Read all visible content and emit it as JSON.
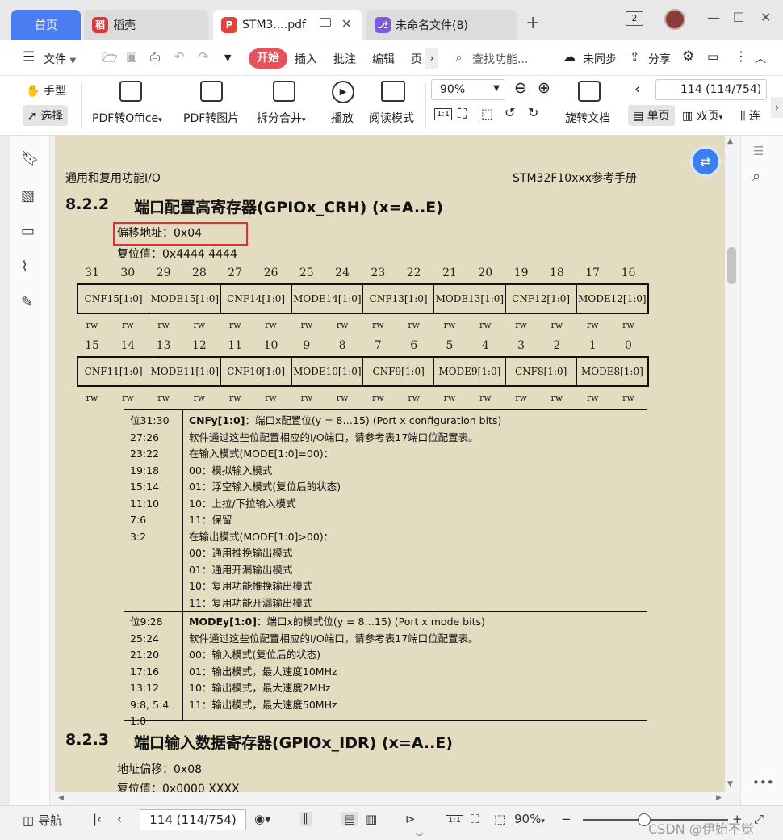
{
  "tabs": [
    {
      "label": "首页",
      "active": false,
      "home": true
    },
    {
      "label": "稻壳",
      "active": false
    },
    {
      "label": "STM3....pdf",
      "active": true
    },
    {
      "label": "未命名文件(8)",
      "active": false
    }
  ],
  "window": {
    "badge": "2"
  },
  "menu": {
    "file": "文件",
    "start": "开始",
    "items": [
      "插入",
      "批注",
      "编辑",
      "页"
    ],
    "search_placeholder": "查找功能...",
    "sync": "未同步",
    "share": "分享"
  },
  "toolbar": {
    "hand": "手型",
    "select": "选择",
    "pdf_office": "PDF转Office",
    "pdf_image": "PDF转图片",
    "split_merge": "拆分合并",
    "play": "播放",
    "read_mode": "阅读模式",
    "zoom": "90%",
    "page_input": "114 (114/754)",
    "rotate": "旋转文档",
    "single": "单页",
    "double": "双页",
    "continuous": "连"
  },
  "doc": {
    "header_left": "通用和复用功能I/O",
    "header_right": "STM32F10xxx参考手册",
    "sec1_num": "8.2.2",
    "sec1_title": "端口配置高寄存器(GPIOx_CRH) (x=A..E)",
    "offset": "偏移地址：0x04",
    "reset": "复位值：0x4444 4444",
    "bits_high": [
      "31",
      "30",
      "29",
      "28",
      "27",
      "26",
      "25",
      "24",
      "23",
      "22",
      "21",
      "20",
      "19",
      "18",
      "17",
      "16"
    ],
    "fields_high": [
      "CNF15[1:0]",
      "MODE15[1:0]",
      "CNF14[1:0]",
      "MODE14[1:0]",
      "CNF13[1:0]",
      "MODE13[1:0]",
      "CNF12[1:0]",
      "MODE12[1:0]"
    ],
    "bits_low": [
      "15",
      "14",
      "13",
      "12",
      "11",
      "10",
      "9",
      "8",
      "7",
      "6",
      "5",
      "4",
      "3",
      "2",
      "1",
      "0"
    ],
    "fields_low": [
      "CNF11[1:0]",
      "MODE11[1:0]",
      "CNF10[1:0]",
      "MODE10[1:0]",
      "CNF9[1:0]",
      "MODE9[1:0]",
      "CNF8[1:0]",
      "MODE8[1:0]"
    ],
    "rw": "rw",
    "cnf_bits": [
      "位31:30",
      "27:26",
      "23:22",
      "19:18",
      "15:14",
      "11:10",
      "7:6",
      "3:2"
    ],
    "cnf_title": "CNFy[1:0]",
    "cnf_title_rest": "：端口x配置位(y = 8…15) (Port x configuration bits)",
    "cnf_lines": [
      "软件通过这些位配置相应的I/O端口，请参考表17端口位配置表。",
      "在输入模式(MODE[1:0]=00)：",
      "00：模拟输入模式",
      "01：浮空输入模式(复位后的状态)",
      "10：上拉/下拉输入模式",
      "11：保留",
      "在输出模式(MODE[1:0]>00)：",
      "00：通用推挽输出模式",
      "01：通用开漏输出模式",
      "10：复用功能推挽输出模式",
      "11：复用功能开漏输出模式"
    ],
    "mode_bits": [
      "位9:28",
      "25:24",
      "21:20",
      "17:16",
      "13:12",
      "9:8, 5:4",
      "1:0"
    ],
    "mode_title": "MODEy[1:0]",
    "mode_title_rest": "：端口x的模式位(y = 8…15) (Port x mode bits)",
    "mode_lines": [
      "软件通过这些位配置相应的I/O端口，请参考表17端口位配置表。",
      "00：输入模式(复位后的状态)",
      "01：输出模式，最大速度10MHz",
      "10：输出模式，最大速度2MHz",
      "11：输出模式，最大速度50MHz"
    ],
    "sec2_num": "8.2.3",
    "sec2_title": "端口输入数据寄存器(GPIOx_IDR) (x=A..E)",
    "sec2_offset": "地址偏移：0x08",
    "sec2_reset": "复位值：0x0000 XXXX"
  },
  "status": {
    "nav": "导航",
    "page": "114 (114/754)",
    "zoom": "90%",
    "watermark": "CSDN @伊始不觉"
  },
  "colors": {
    "accent": "#4a7cf2",
    "start_btn": "#e8505b",
    "highlight_box": "#e03030",
    "page_bg": "#e4dcc0"
  }
}
